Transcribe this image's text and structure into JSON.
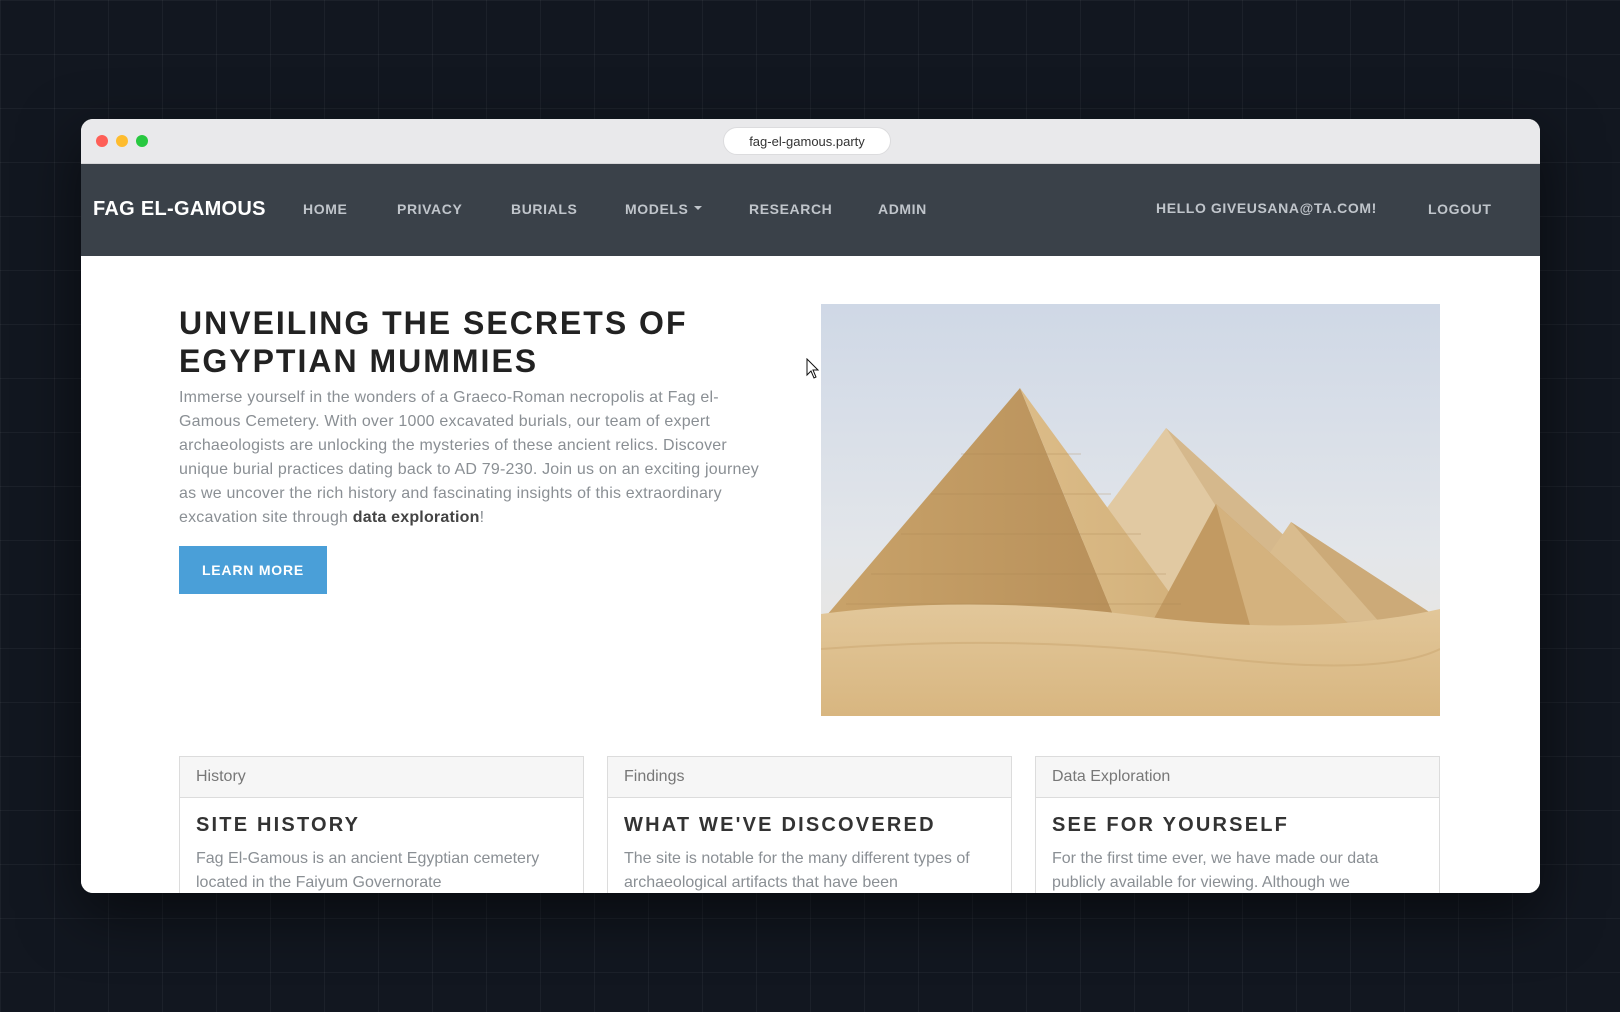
{
  "browser": {
    "url": "fag-el-gamous.party"
  },
  "navbar": {
    "brand": "FAG EL-GAMOUS",
    "links": [
      {
        "label": "HOME"
      },
      {
        "label": "PRIVACY"
      },
      {
        "label": "BURIALS"
      },
      {
        "label": "MODELS"
      },
      {
        "label": "RESEARCH"
      },
      {
        "label": "ADMIN"
      }
    ],
    "greeting": "HELLO GIVEUSANA@TA.COM!",
    "logout": "LOGOUT"
  },
  "hero": {
    "title": "UNVEILING THE SECRETS OF EGYPTIAN MUMMIES",
    "text_before": "Immerse yourself in the wonders of a Graeco-Roman necropolis at Fag el-Gamous Cemetery. With over 1000 excavated burials, our team of expert archaeologists are unlocking the mysteries of these ancient relics. Discover unique burial practices dating back to AD 79-230. Join us on an exciting journey as we uncover the rich history and fascinating insights of this extraordinary excavation site through ",
    "text_link": "data exploration",
    "text_after": "!",
    "button": "LEARN MORE",
    "image": "pyramids-of-giza"
  },
  "cards": [
    {
      "header": "History",
      "title": "SITE HISTORY",
      "text": "Fag El-Gamous is an ancient Egyptian cemetery located in the Faiyum Governorate"
    },
    {
      "header": "Findings",
      "title": "WHAT WE'VE DISCOVERED",
      "text": "The site is notable for the many different types of archaeological artifacts that have been"
    },
    {
      "header": "Data Exploration",
      "title": "SEE FOR YOURSELF",
      "text": "For the first time ever, we have made our data publicly available for viewing. Although we"
    }
  ]
}
